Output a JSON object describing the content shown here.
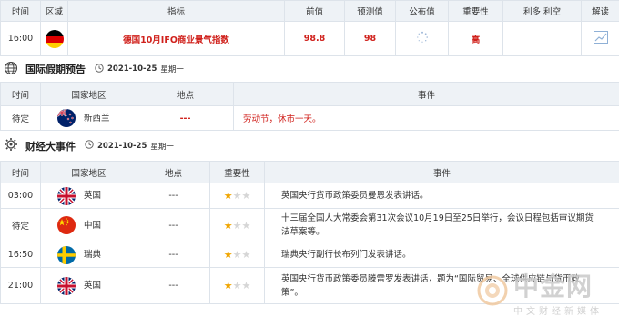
{
  "top": {
    "headers": [
      "时间",
      "区域",
      "指标",
      "前值",
      "预测值",
      "公布值",
      "重要性",
      "利多 利空",
      "解读"
    ],
    "row": {
      "time": "16:00",
      "indicator": "德国10月IFO商业景气指数",
      "previous": "98.8",
      "forecast": "98",
      "importance": "高"
    }
  },
  "holiday": {
    "title": "国际假期预告",
    "date": "2021-10-25",
    "weekday": "星期一",
    "headers": [
      "时间",
      "国家地区",
      "地点",
      "事件"
    ],
    "rows": [
      {
        "time": "待定",
        "country": "新西兰",
        "place": "---",
        "event": "劳动节，休市一天。"
      }
    ]
  },
  "finance": {
    "title": "财经大事件",
    "date": "2021-10-25",
    "weekday": "星期一",
    "headers": [
      "时间",
      "国家地区",
      "地点",
      "重要性",
      "事件"
    ],
    "rows": [
      {
        "time": "03:00",
        "country": "英国",
        "place": "---",
        "stars": 1,
        "event": "英国央行货币政策委员曼恩发表讲话。"
      },
      {
        "time": "待定",
        "country": "中国",
        "place": "---",
        "stars": 1,
        "event": "十三届全国人大常委会第31次会议10月19日至25日举行，会议日程包括审议期货法草案等。"
      },
      {
        "time": "16:50",
        "country": "瑞典",
        "place": "---",
        "stars": 1,
        "event": "瑞典央行副行长布列门发表讲话。"
      },
      {
        "time": "21:00",
        "country": "英国",
        "place": "---",
        "stars": 1,
        "event": "英国央行货币政策委员滕雷罗发表讲话，题为“国际贸易、全球供应链与货币政策”。"
      }
    ]
  },
  "watermark": {
    "main": "中金网",
    "sub": "中文财经新媒体"
  },
  "colors": {
    "accent_red": "#d0211c",
    "header_bg": "#eef2f6",
    "star": "#f0a500"
  }
}
